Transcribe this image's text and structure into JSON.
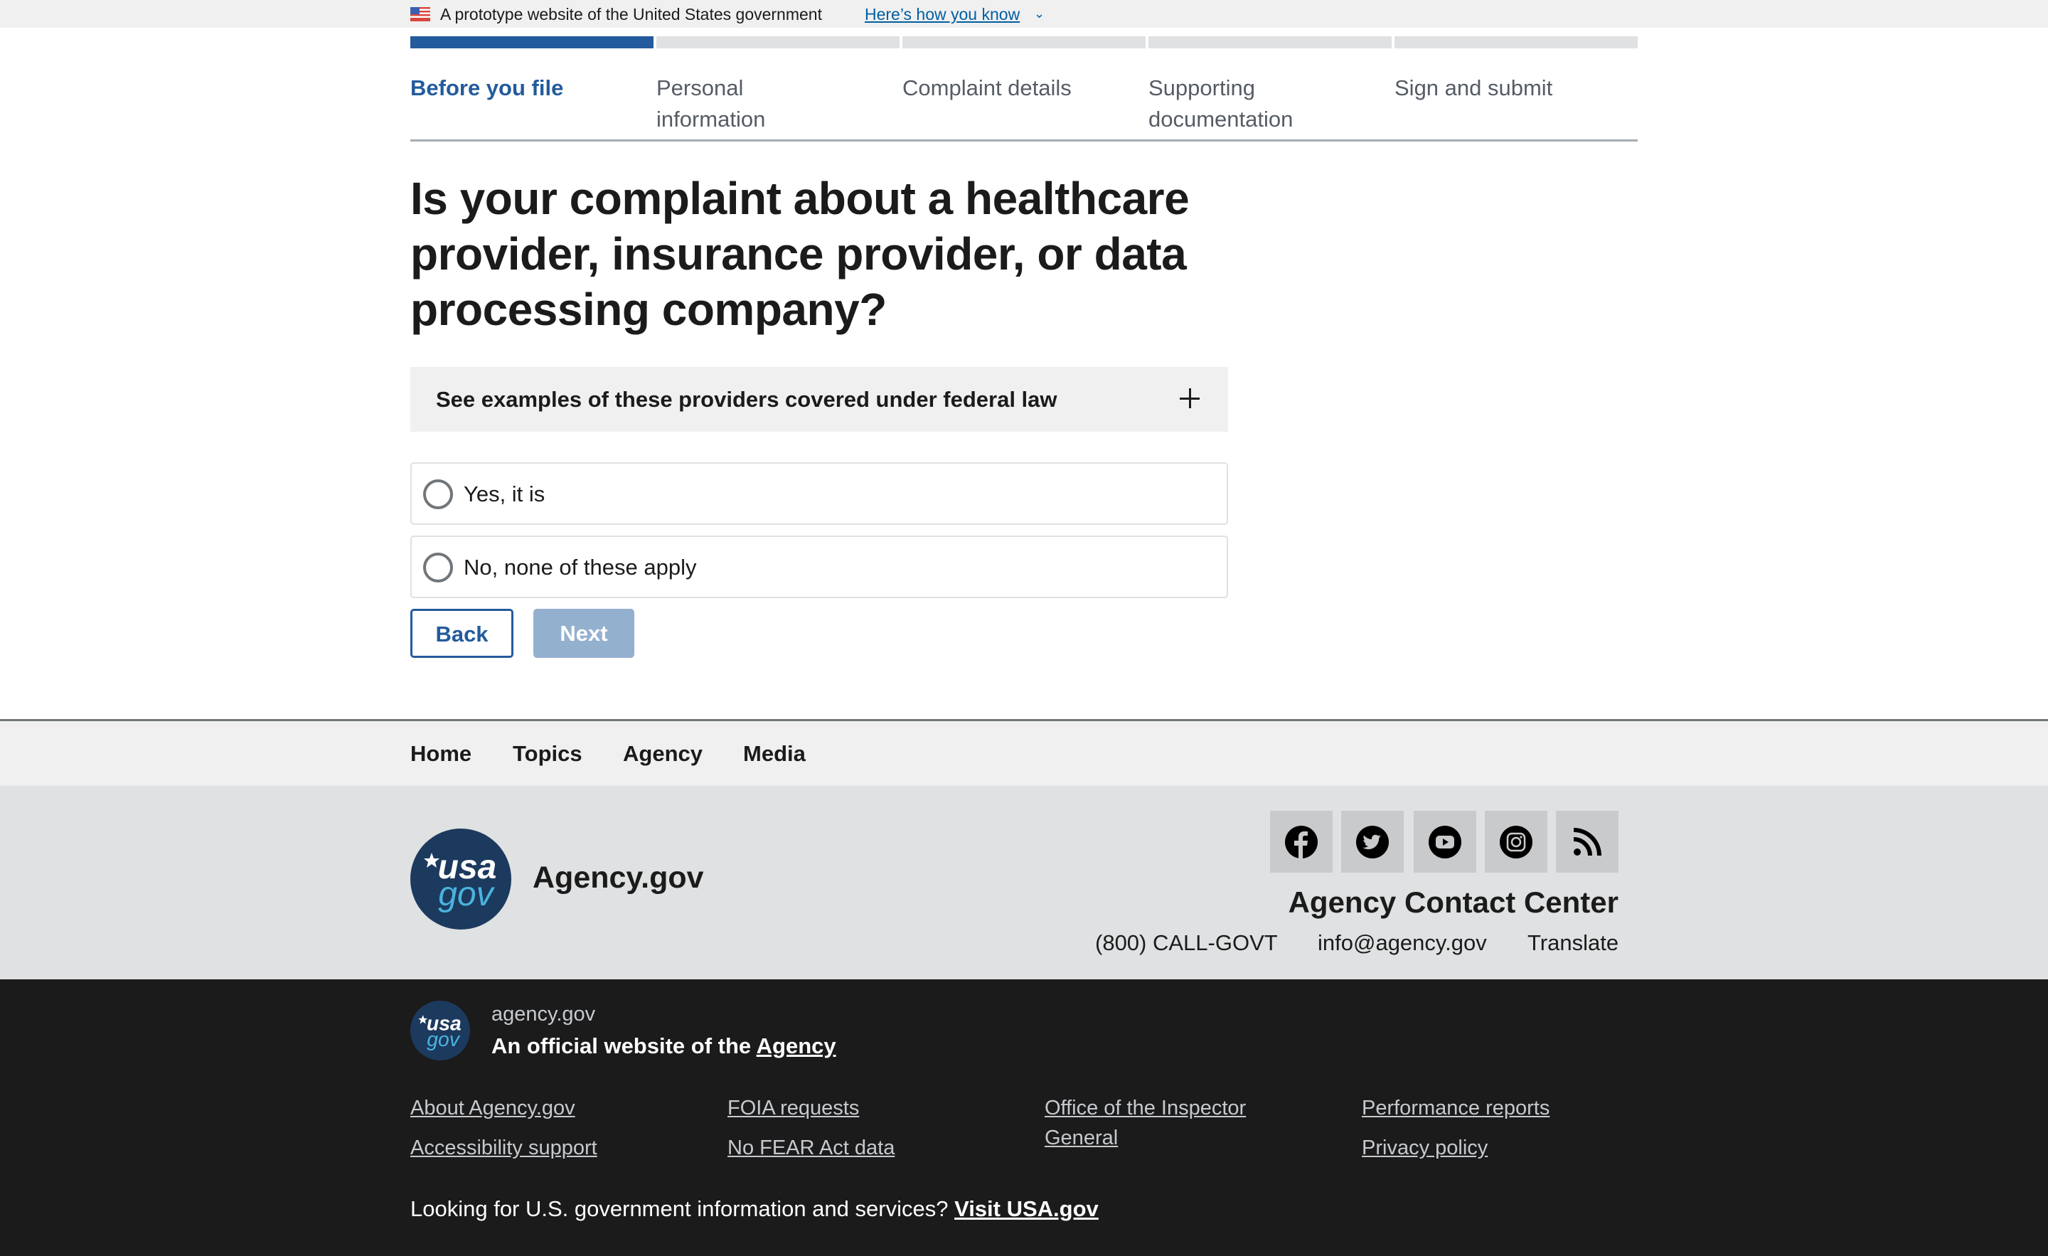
{
  "gov_banner": {
    "text": "A prototype website of the United States government",
    "link": "Here’s how you know",
    "flag_icon": "us-flag-icon",
    "chevron_icon": "chevron-down-icon"
  },
  "stepper": {
    "steps": [
      {
        "label": "Before you file",
        "status": "current"
      },
      {
        "label": "Personal information",
        "status": "upcoming"
      },
      {
        "label": "Complaint details",
        "status": "upcoming"
      },
      {
        "label": "Supporting documentation",
        "status": "upcoming"
      },
      {
        "label": "Sign and submit",
        "status": "upcoming"
      }
    ],
    "current_index": 1,
    "total": 5
  },
  "main": {
    "heading": "Is your complaint about a healthcare provider, insurance provider, or data processing company?",
    "accordion": {
      "label": "See examples of these providers covered under federal law",
      "expanded": false,
      "icon": "plus-icon"
    },
    "options": [
      {
        "label": "Yes, it is",
        "checked": false
      },
      {
        "label": "No, none of these apply",
        "checked": false
      }
    ],
    "buttons": {
      "back": "Back",
      "next": "Next",
      "next_disabled": true
    }
  },
  "footer": {
    "nav": [
      "Home",
      "Topics",
      "Agency",
      "Media"
    ],
    "logo": {
      "line1": "usa",
      "line2": "gov"
    },
    "agency_name": "Agency.gov",
    "social": [
      "facebook-icon",
      "twitter-icon",
      "youtube-icon",
      "instagram-icon",
      "rss-icon"
    ],
    "contact_title": "Agency Contact Center",
    "phone": "(800) CALL-GOVT",
    "email": "info@agency.gov",
    "translate": "Translate"
  },
  "identifier": {
    "domain": "agency.gov",
    "official_prefix": "An official website of the",
    "official_link": "Agency",
    "links": [
      "About Agency.gov",
      "Accessibility support",
      "FOIA requests",
      "No FEAR Act data",
      "Office of the Inspector General",
      "Performance reports",
      "Privacy policy"
    ],
    "usa_prefix": "Looking for U.S. government information and services?",
    "usa_link": "Visit USA.gov"
  },
  "colors": {
    "primary": "#235b9c",
    "disabled_button": "#94b0cf",
    "banner_bg": "#f0f0f0",
    "footer_mid_bg": "#dfe1e2",
    "identifier_bg": "#1b1b1b",
    "logo_navy": "#1c3a5e",
    "logo_cyan": "#4ab3de"
  }
}
